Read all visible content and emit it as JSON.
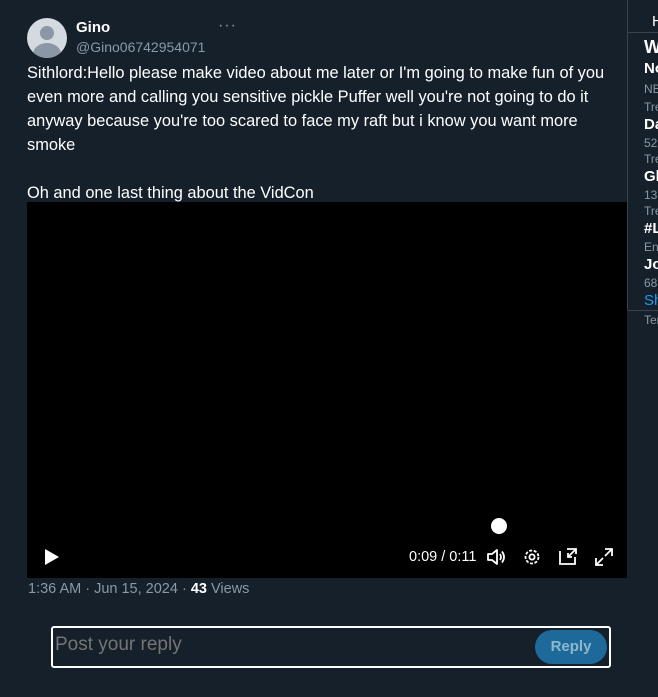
{
  "tweet": {
    "author_name": "Gino",
    "author_handle": "@Gino06742954071",
    "more_label": "···",
    "text": "Sithlord:Hello please make video about me later or I'm going to make fun of you even more and calling you sensitive pickle Puffer well you're not going to do it anyway because you're too scared to face my raft but i know you want more smoke\n\nOh and one last thing about the VidCon",
    "timestamp": "1:36 AM · Jun 15, 2024 · ",
    "views_count": "43",
    "views_label": " Views"
  },
  "video": {
    "time": "0:09 / 0:11",
    "progress": 0.82
  },
  "reply": {
    "placeholder": "Post your reply",
    "button_label": "Reply"
  },
  "sidebar": {
    "tab_partial": "H",
    "title_partial": "W",
    "items": [
      {
        "title": "No",
        "meta": "NB",
        "trend": "Tre"
      },
      {
        "title": "Da",
        "meta": "52",
        "trend": "Tre"
      },
      {
        "title": "Gl",
        "meta": "13",
        "trend": "Tre"
      },
      {
        "title": "#L",
        "meta": "En",
        "trend": ""
      },
      {
        "title": "Jo",
        "meta": "68",
        "trend": ""
      }
    ],
    "show_more_partial": "Sh",
    "terms_partial": "Ter"
  },
  "colors": {
    "background": "#15202b",
    "accent": "#1d9bf0",
    "muted": "#8b98a5",
    "reply_button": "#1d6a9a"
  }
}
